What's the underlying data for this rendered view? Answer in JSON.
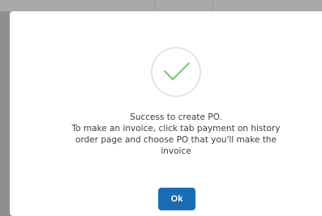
{
  "dialog": {
    "message_lines": [
      "Success to create PO.",
      "To make an invoice, click tab payment on history",
      "order page and choose PO that you'll make the",
      "invoice"
    ],
    "ok_label": "Ok",
    "icon": "checkmark-icon"
  },
  "colors": {
    "success": "#7cc576",
    "success_ring": "#d9ecd7",
    "primary_button": "#1b6cb5",
    "overlay": "#8c8c8c"
  }
}
